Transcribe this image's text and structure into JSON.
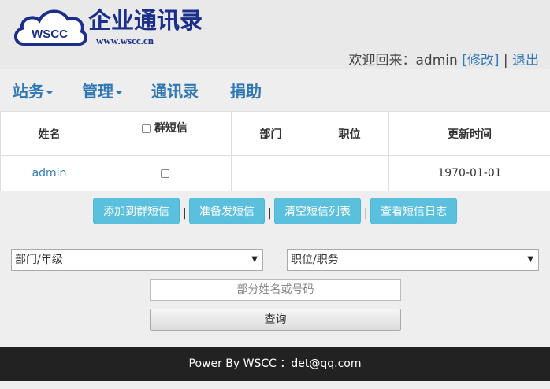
{
  "header": {
    "logo_badge": "WSCC",
    "logo_title": "企业通讯录",
    "logo_url": "www.wscc.cn",
    "welcome_text": "欢迎回来：admin",
    "modify_link": "[修改]",
    "separator": "|",
    "logout_link": "退出"
  },
  "nav": {
    "items": [
      {
        "label": "站务",
        "has_dropdown": true
      },
      {
        "label": "管理",
        "has_dropdown": true
      },
      {
        "label": "通讯录",
        "has_dropdown": false
      },
      {
        "label": "捐助",
        "has_dropdown": false
      }
    ]
  },
  "table": {
    "headers": {
      "name": "姓名",
      "group_sms": "群短信",
      "department": "部门",
      "position": "职位",
      "updated": "更新时间"
    },
    "rows": [
      {
        "name": "admin",
        "group_sms_checked": false,
        "department": "",
        "position": "",
        "updated": "1970-01-01"
      }
    ]
  },
  "actions": {
    "add_to_group": "添加到群短信",
    "prepare_sms": "准备发短信",
    "clear_list": "清空短信列表",
    "view_log": "查看短信日志",
    "separator": "|"
  },
  "filters": {
    "department_select": "部门/年级",
    "position_select": "职位/职务",
    "search_placeholder": "部分姓名或号码",
    "query_button": "查询"
  },
  "footer": {
    "text": "Power By WSCC ：det@qq.com"
  },
  "colors": {
    "accent": "#2f77b5",
    "info_button": "#5bc0de",
    "footer_bg": "#222222"
  }
}
